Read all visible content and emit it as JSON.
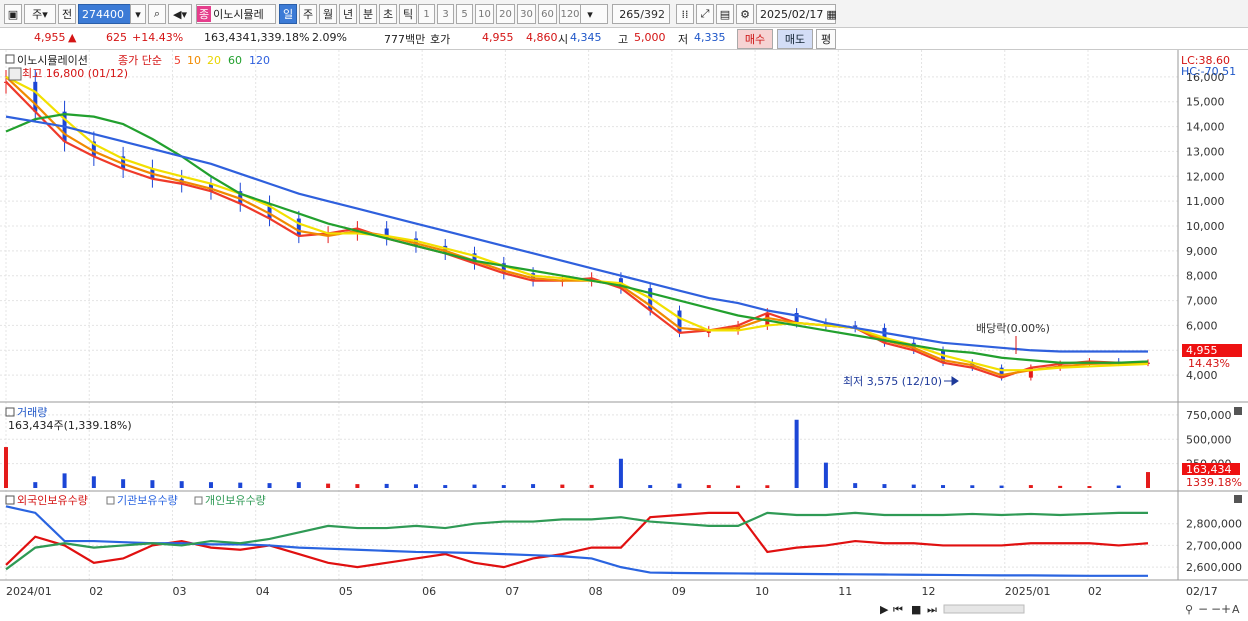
{
  "toolbar": {
    "market": "주",
    "prev_label": "전",
    "code": "274400",
    "stock_name": "이노시뮬레",
    "stock_badge": "종",
    "period_tabs": [
      "일",
      "주",
      "월",
      "년",
      "분",
      "초",
      "틱"
    ],
    "selected_period": "일",
    "intervals": [
      "1",
      "3",
      "5",
      "10",
      "20",
      "30",
      "60",
      "120"
    ],
    "count": "265",
    "total": "/392",
    "date": "2025/02/17"
  },
  "quote": {
    "price": "4,955",
    "change_arrow": "▲",
    "change": "625",
    "change_pct": "+14.43%",
    "volume": "163,434",
    "volume_pct": "1,339.18%",
    "turnover": "2.09%",
    "amount": "777백만",
    "ask_label": "호가",
    "ask": "4,955",
    "bid": "4,860",
    "open_label": "시",
    "open": "4,345",
    "high_label": "고",
    "high": "5,000",
    "low_label": "저",
    "low": "4,335",
    "buy": "매수",
    "sell": "매도",
    "eval": "평"
  },
  "price_panel": {
    "name": "이노시뮬레이션",
    "legend_title": "종가 단순",
    "ma_labels": [
      "5",
      "10",
      "20",
      "60",
      "120"
    ],
    "max_note": "최고 16,800 (01/12)",
    "min_note": "최저 3,575 (12/10)",
    "dividend_note": "배당락(0.00%)",
    "lc": "LC:38.60",
    "hc": "HC:-70.51",
    "last_tag": "4,955",
    "last_pct": "14.43%"
  },
  "volume_panel": {
    "title": "거래량",
    "value": "163,434주(1,339.18%)",
    "last_tag": "163,434",
    "last_pct": "1339.18%"
  },
  "holdings_panel": {
    "legend": [
      "외국인보유수량",
      "기관보유수량",
      "개인보유수량"
    ]
  },
  "x_axis": {
    "labels": [
      "2024/01",
      "02",
      "03",
      "04",
      "05",
      "06",
      "07",
      "08",
      "09",
      "10",
      "11",
      "12",
      "2025/01",
      "02"
    ],
    "right_label": "02/17"
  },
  "colors": {
    "up": "#e41b1b",
    "down": "#1c46d6",
    "ma5": "#ef3a2a",
    "ma10": "#f08a00",
    "ma20": "#f2e000",
    "ma60": "#22a02e",
    "ma120": "#2f60dd",
    "foreign": "#e01010",
    "institution": "#2a64e0",
    "individual": "#2f9a55"
  },
  "chart_data": {
    "type": "line",
    "title": "이노시뮬레이션",
    "price_axis": {
      "ticks": [
        16000,
        15000,
        14000,
        13000,
        12000,
        11000,
        10000,
        9000,
        8000,
        7000,
        6000,
        5000,
        4000
      ],
      "ylim": [
        3000,
        17000
      ]
    },
    "volume_axis": {
      "ticks": [
        750000,
        500000,
        250000
      ],
      "ylim": [
        0,
        800000
      ]
    },
    "holdings_axis": {
      "ticks": [
        2800000,
        2700000,
        2600000
      ],
      "ylim": [
        2550000,
        2900000
      ]
    },
    "x_months": [
      "2024/01",
      "02",
      "03",
      "04",
      "05",
      "06",
      "07",
      "08",
      "09",
      "10",
      "11",
      "12",
      "2025/01",
      "02"
    ],
    "series": [
      {
        "name": "5",
        "values": [
          15800,
          14600,
          13400,
          12800,
          12300,
          11900,
          11700,
          11400,
          10900,
          10300,
          9600,
          9700,
          9900,
          9500,
          9200,
          8900,
          8500,
          8100,
          7800,
          7800,
          7900,
          7500,
          6600,
          5700,
          5800,
          6000,
          6500,
          6100,
          6000,
          5900,
          5300,
          5000,
          4500,
          4300,
          3900,
          4300,
          4450,
          4550,
          4500,
          4500
        ]
      },
      {
        "name": "10",
        "values": [
          16000,
          14900,
          13700,
          13000,
          12500,
          12100,
          11800,
          11500,
          11100,
          10500,
          9800,
          9600,
          9800,
          9600,
          9300,
          9000,
          8600,
          8200,
          7900,
          7800,
          7800,
          7600,
          6800,
          5900,
          5800,
          5900,
          6300,
          6100,
          6000,
          5900,
          5400,
          5100,
          4600,
          4400,
          4000,
          4200,
          4350,
          4450,
          4480,
          4500
        ]
      },
      {
        "name": "20",
        "values": [
          16000,
          15400,
          14300,
          13300,
          12700,
          12300,
          12000,
          11700,
          11300,
          10800,
          10100,
          9700,
          9700,
          9600,
          9400,
          9100,
          8800,
          8400,
          8000,
          7900,
          7800,
          7700,
          7100,
          6300,
          5800,
          5800,
          6000,
          6100,
          6000,
          5900,
          5500,
          5200,
          4800,
          4500,
          4200,
          4200,
          4300,
          4350,
          4400,
          4450
        ]
      },
      {
        "name": "60",
        "values": [
          13800,
          14300,
          14500,
          14400,
          14100,
          13500,
          12800,
          12000,
          11300,
          10900,
          10500,
          10100,
          9800,
          9500,
          9200,
          8900,
          8600,
          8400,
          8200,
          8000,
          7800,
          7600,
          7300,
          7000,
          6700,
          6400,
          6200,
          6000,
          5800,
          5600,
          5400,
          5200,
          5000,
          4900,
          4700,
          4600,
          4500,
          4500,
          4500,
          4550
        ]
      },
      {
        "name": "120",
        "values": [
          14400,
          14200,
          14000,
          13700,
          13400,
          13100,
          12800,
          12500,
          12100,
          11700,
          11300,
          11000,
          10700,
          10400,
          10100,
          9800,
          9500,
          9200,
          8900,
          8600,
          8300,
          8000,
          7700,
          7400,
          7100,
          6900,
          6600,
          6400,
          6100,
          5900,
          5700,
          5500,
          5300,
          5200,
          5100,
          5000,
          4950,
          4950,
          4950,
          4950
        ]
      },
      {
        "name": "외국인보유수량",
        "values": [
          2610000,
          2740000,
          2700000,
          2620000,
          2640000,
          2700000,
          2720000,
          2690000,
          2680000,
          2700000,
          2660000,
          2620000,
          2600000,
          2620000,
          2640000,
          2660000,
          2620000,
          2600000,
          2640000,
          2660000,
          2690000,
          2690000,
          2830000,
          2840000,
          2850000,
          2850000,
          2670000,
          2690000,
          2700000,
          2720000,
          2710000,
          2710000,
          2700000,
          2700000,
          2700000,
          2710000,
          2710000,
          2710000,
          2700000,
          2710000
        ]
      },
      {
        "name": "기관보유수량",
        "values": [
          2880000,
          2850000,
          2720000,
          2720000,
          2715000,
          2710000,
          2710000,
          2705000,
          2705000,
          2700000,
          2690000,
          2685000,
          2680000,
          2675000,
          2670000,
          2668000,
          2665000,
          2660000,
          2655000,
          2650000,
          2640000,
          2600000,
          2575000,
          2573000,
          2572000,
          2571000,
          2570000,
          2569000,
          2568000,
          2567000,
          2566000,
          2565000,
          2564000,
          2563000,
          2562000,
          2562000,
          2561000,
          2560000,
          2560000,
          2560000
        ]
      },
      {
        "name": "개인보유수량",
        "values": [
          2590000,
          2690000,
          2710000,
          2690000,
          2700000,
          2710000,
          2700000,
          2720000,
          2710000,
          2730000,
          2760000,
          2790000,
          2780000,
          2780000,
          2790000,
          2780000,
          2800000,
          2810000,
          2810000,
          2820000,
          2820000,
          2830000,
          2810000,
          2800000,
          2790000,
          2790000,
          2850000,
          2840000,
          2840000,
          2850000,
          2840000,
          2840000,
          2840000,
          2845000,
          2840000,
          2845000,
          2840000,
          2845000,
          2850000,
          2850000
        ]
      }
    ],
    "volume_values": [
      420000,
      60000,
      150000,
      120000,
      90000,
      80000,
      70000,
      60000,
      55000,
      50000,
      60000,
      45000,
      40000,
      42000,
      38000,
      30000,
      35000,
      30000,
      40000,
      35000,
      32000,
      300000,
      30000,
      45000,
      30000,
      25000,
      28000,
      700000,
      260000,
      50000,
      40000,
      35000,
      30000,
      28000,
      25000,
      30000,
      22000,
      20000,
      25000,
      163434
    ],
    "annotations": [
      "최고 16,800 (01/12)",
      "최저 3,575 (12/10)",
      "배당락(0.00%)"
    ]
  }
}
